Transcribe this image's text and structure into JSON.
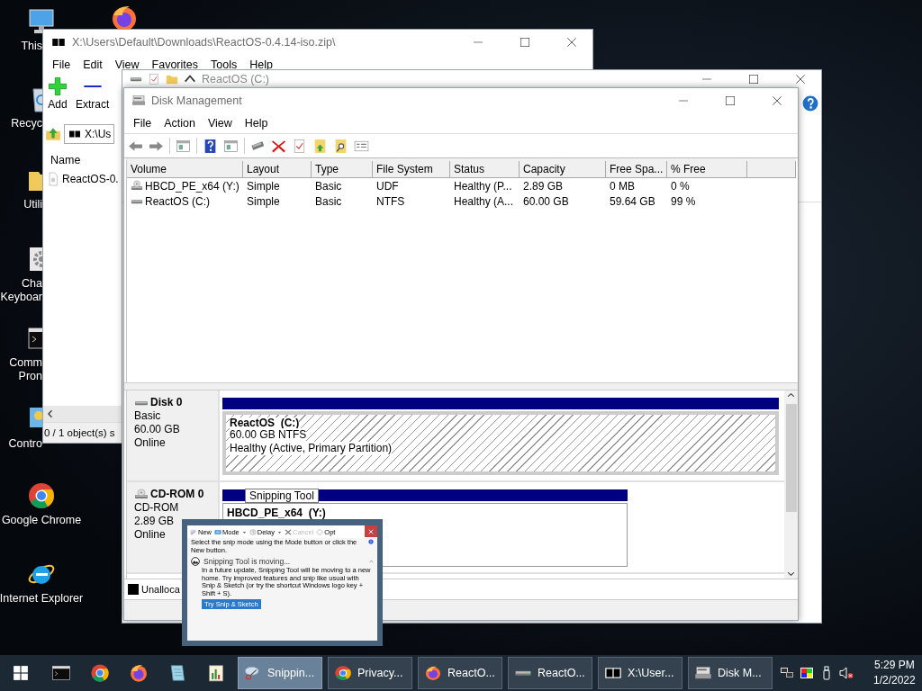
{
  "desktop": {
    "icons": [
      {
        "kind": "pc",
        "lines": [
          "This"
        ]
      },
      {
        "kind": "firefox"
      },
      {
        "kind": "recycle",
        "lines": [
          "Recyc"
        ]
      },
      {
        "kind": "folder",
        "lines": [
          "Utili"
        ]
      },
      {
        "kind": "gear",
        "lines": [
          "Cha",
          "Keyboar"
        ]
      },
      {
        "kind": "cmd",
        "lines": [
          "Comm",
          "Pron"
        ]
      },
      {
        "kind": "control",
        "lines": [
          "Contro"
        ]
      },
      {
        "kind": "chrome",
        "lines": [
          "Google Chrome"
        ]
      },
      {
        "kind": "ie",
        "lines": [
          "Internet Explorer"
        ]
      }
    ]
  },
  "zip_window": {
    "title": "X:\\Users\\Default\\Downloads\\ReactOS-0.4.14-iso.zip\\",
    "menu": [
      "File",
      "Edit",
      "View",
      "Favorites",
      "Tools",
      "Help"
    ],
    "toolbar": [
      {
        "kind": "add",
        "label": "Add"
      },
      {
        "kind": "extract",
        "label": "Extract"
      }
    ],
    "address": "X:\\Us",
    "columns": [
      "Name"
    ],
    "rows": [
      "ReactOS-0."
    ],
    "status": "0 / 1 object(s) s"
  },
  "explorer_window": {
    "title": "ReactOS (C:)"
  },
  "disk_management": {
    "title": "Disk Management",
    "menu": [
      "File",
      "Action",
      "View",
      "Help"
    ],
    "columns": [
      "Volume",
      "Layout",
      "Type",
      "File System",
      "Status",
      "Capacity",
      "Free Spa...",
      "% Free"
    ],
    "volumes": [
      {
        "kind": "cd",
        "cells": [
          "HBCD_PE_x64 (Y:)",
          "Simple",
          "Basic",
          "UDF",
          "Healthy (P...",
          "2.89 GB",
          "0 MB",
          "0 %"
        ]
      },
      {
        "kind": "hdd",
        "cells": [
          "ReactOS (C:)",
          "Simple",
          "Basic",
          "NTFS",
          "Healthy (A...",
          "60.00 GB",
          "59.64 GB",
          "99 %"
        ]
      }
    ],
    "disks": [
      {
        "kind": "hdd",
        "name": "Disk 0",
        "lines": [
          "Basic",
          "60.00 GB",
          "Online"
        ],
        "partition": {
          "kind": "hatched",
          "name": "ReactOS  (C:)",
          "lines": [
            "60.00 GB NTFS",
            "Healthy (Active, Primary Partition)"
          ]
        }
      },
      {
        "kind": "cd",
        "name": "CD-ROM 0",
        "lines": [
          "CD-ROM",
          "2.89 GB",
          "Online"
        ],
        "partition": {
          "kind": "plain",
          "name": "HBCD_PE_x64  (Y:)"
        }
      }
    ],
    "legend": [
      {
        "label": "Unalloca",
        "color": "#000000"
      }
    ]
  },
  "tooltip": {
    "text": "Snipping Tool"
  },
  "snip_preview": {
    "toolbar": [
      {
        "kind": "new",
        "label": "New",
        "disabled": false
      },
      {
        "kind": "mode",
        "label": "Mode",
        "disabled": false
      },
      {
        "kind": "delay",
        "label": "Delay",
        "disabled": false
      },
      {
        "kind": "cancel",
        "label": "Cancel",
        "disabled": true
      },
      {
        "kind": "options",
        "label": "Opt",
        "disabled": false
      }
    ],
    "hint": "Select the snip mode using the Mode button or click the New button.",
    "notice_title": "Snipping Tool is moving...",
    "notice_body": "In a future update, Snipping Tool will be moving to a new home. Try improved features and snip like usual with Snip & Sketch (or try the shortcut Windows logo key + Shift + S).",
    "action": "Try Snip & Sketch"
  },
  "taskbar": {
    "pinned": [
      {
        "kind": "cmd"
      },
      {
        "kind": "chrome"
      },
      {
        "kind": "firefox"
      },
      {
        "kind": "notepad"
      },
      {
        "kind": "chart"
      }
    ],
    "tasks": [
      {
        "kind": "snip",
        "label": "Snippin...",
        "selected": true
      },
      {
        "kind": "chrome",
        "label": "Privacy...",
        "selected": false
      },
      {
        "kind": "firefox",
        "label": "ReactO...",
        "selected": false
      },
      {
        "kind": "hdd",
        "label": "ReactO...",
        "selected": false
      },
      {
        "kind": "zip",
        "label": "X:\\User...",
        "selected": false
      },
      {
        "kind": "dm",
        "label": "Disk M...",
        "selected": false
      }
    ],
    "clock": {
      "time": "5:29 PM",
      "date": "1/2/2022"
    }
  }
}
